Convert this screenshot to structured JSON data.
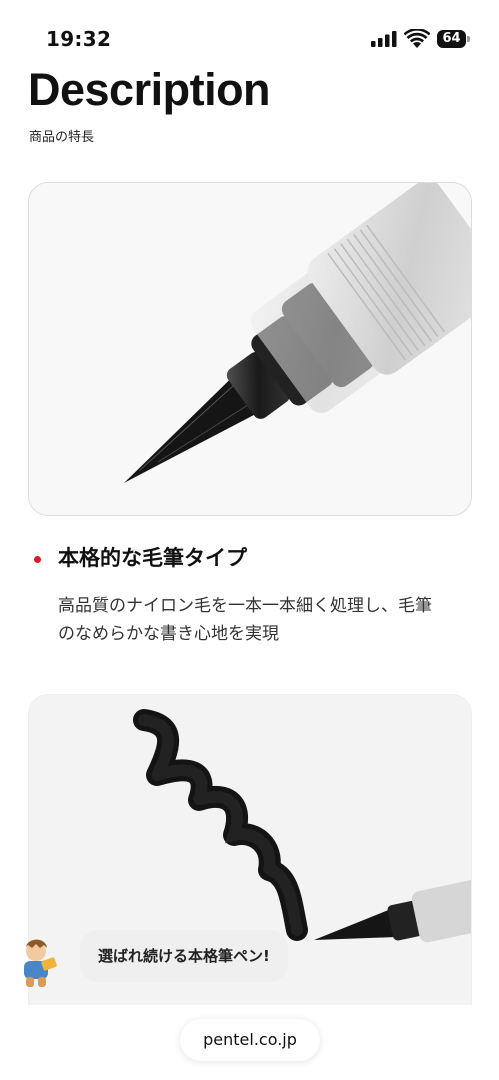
{
  "status_bar": {
    "time": "19:32",
    "battery": "64"
  },
  "header": {
    "title": "Description",
    "subtitle": "商品の特長"
  },
  "feature": {
    "title": "本格的な毛筆タイプ",
    "description": "高品質のナイロン毛を一本一本細く処理し、毛筆のなめらかな書き心地を実現",
    "bullet_color": "#d81b2b"
  },
  "chat": {
    "message": "選ばれ続ける本格筆ペン!"
  },
  "browser": {
    "url": "pentel.co.jp"
  }
}
